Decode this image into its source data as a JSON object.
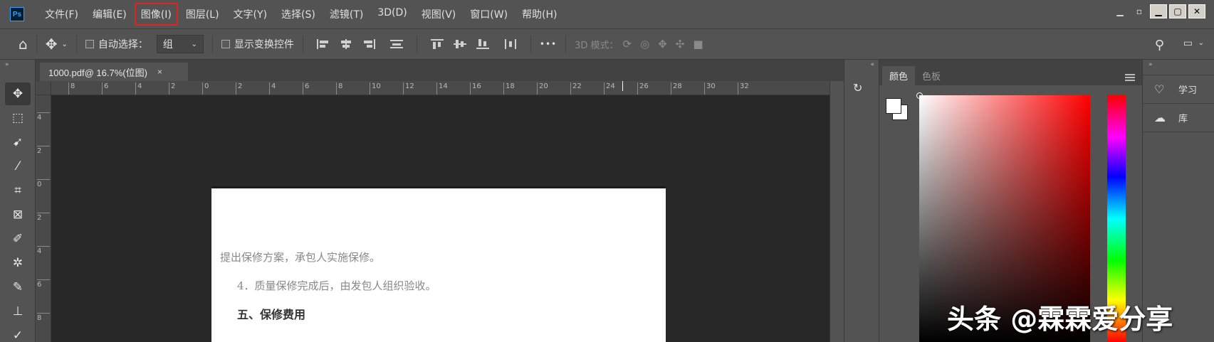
{
  "menubar": {
    "items": [
      {
        "label": "文件(F)"
      },
      {
        "label": "编辑(E)"
      },
      {
        "label": "图像(I)",
        "highlighted": true
      },
      {
        "label": "图层(L)"
      },
      {
        "label": "文字(Y)"
      },
      {
        "label": "选择(S)"
      },
      {
        "label": "滤镜(T)"
      },
      {
        "label": "3D(D)"
      },
      {
        "label": "视图(V)"
      },
      {
        "label": "窗口(W)"
      },
      {
        "label": "帮助(H)"
      }
    ],
    "logo_text": "Ps"
  },
  "options": {
    "auto_select_label": "自动选择：",
    "group_select_value": "组",
    "show_transform_label": "显示变换控件",
    "more_label": "•••",
    "mode_3d_label": "3D 模式："
  },
  "document": {
    "tab_title": "1000.pdf@ 16.7%(位图)",
    "close_glyph": "×",
    "ruler_h": [
      "8",
      "6",
      "4",
      "2",
      "0",
      "2",
      "4",
      "6",
      "8",
      "10",
      "12",
      "14",
      "16",
      "18",
      "20",
      "22",
      "24",
      "26",
      "28",
      "30",
      "32"
    ],
    "ruler_v": [
      "4",
      "2",
      "0",
      "2",
      "4",
      "6",
      "8"
    ],
    "lines": [
      {
        "text": "提出保修方案，承包人实施保修。",
        "style": "normal"
      },
      {
        "text": "4．质量保修完成后，由发包人组织验收。",
        "style": "normal"
      },
      {
        "text": "五、保修费用",
        "style": "bold"
      }
    ]
  },
  "color_panel": {
    "tab_color": "颜色",
    "tab_swatches": "色板",
    "foreground": "#ffffff",
    "background": "#ffffff"
  },
  "right_panels": {
    "learn_label": "学习",
    "library_label": "库"
  },
  "watermark": "头条 @霖霖爱分享",
  "icons": {
    "home": "⌂",
    "move": "✥",
    "search": "⚲",
    "history": "↻"
  }
}
